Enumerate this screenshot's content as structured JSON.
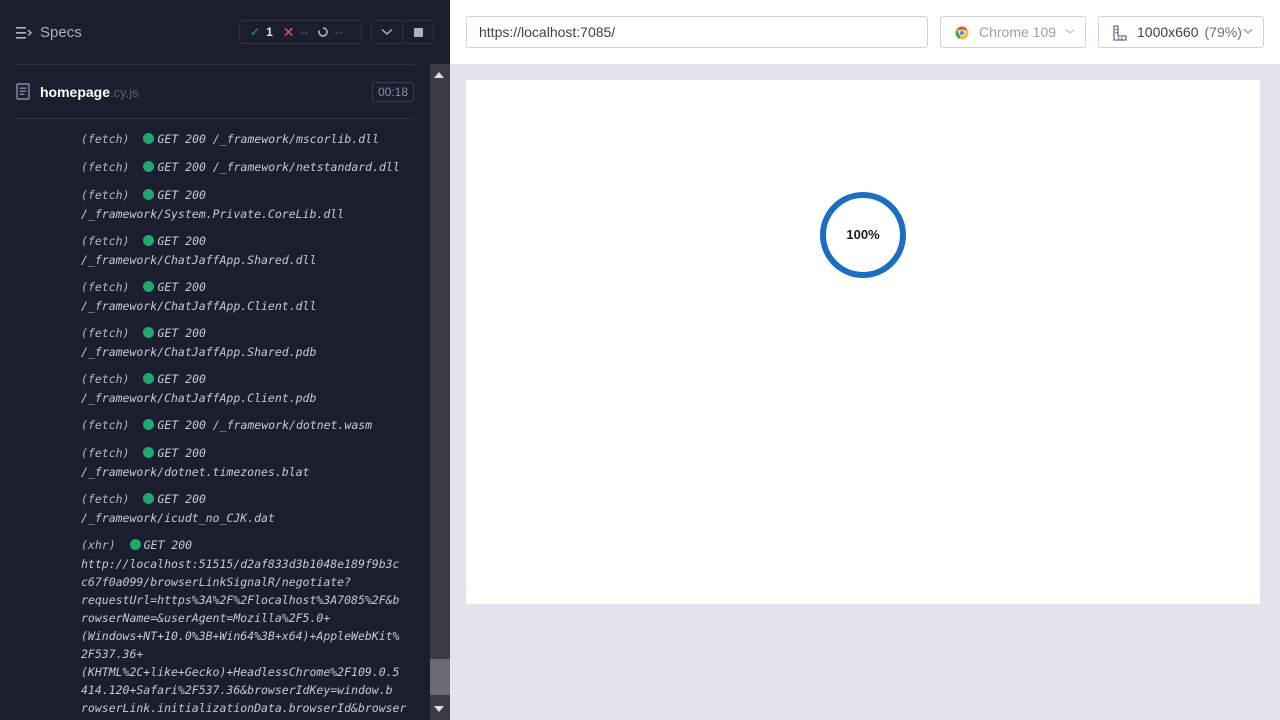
{
  "reporter": {
    "specs_label": "Specs",
    "stats": {
      "passed": "1",
      "failed": "--",
      "pending": "--"
    },
    "spec": {
      "name": "homepage",
      "ext": ".cy.js",
      "duration": "00:18"
    },
    "log": [
      {
        "kind": "(fetch)",
        "lines": [
          "GET 200 /_framework/mscorlib.dll"
        ]
      },
      {
        "kind": "(fetch)",
        "lines": [
          "GET 200 /_framework/netstandard.dll"
        ]
      },
      {
        "kind": "(fetch)",
        "lines": [
          "GET 200",
          "/_framework/System.Private.CoreLib.dll"
        ]
      },
      {
        "kind": "(fetch)",
        "lines": [
          "GET 200",
          "/_framework/ChatJaffApp.Shared.dll"
        ]
      },
      {
        "kind": "(fetch)",
        "lines": [
          "GET 200",
          "/_framework/ChatJaffApp.Client.dll"
        ]
      },
      {
        "kind": "(fetch)",
        "lines": [
          "GET 200",
          "/_framework/ChatJaffApp.Shared.pdb"
        ]
      },
      {
        "kind": "(fetch)",
        "lines": [
          "GET 200",
          "/_framework/ChatJaffApp.Client.pdb"
        ]
      },
      {
        "kind": "(fetch)",
        "lines": [
          "GET 200 /_framework/dotnet.wasm"
        ]
      },
      {
        "kind": "(fetch)",
        "lines": [
          "GET 200",
          "/_framework/dotnet.timezones.blat"
        ]
      },
      {
        "kind": "(fetch)",
        "lines": [
          "GET 200",
          "/_framework/icudt_no_CJK.dat"
        ]
      },
      {
        "kind": "(xhr)",
        "lines": [
          "GET 200",
          "http://localhost:51515/d2af833d3b1048e189f9b3c",
          "c67f0a099/browserLinkSignalR/negotiate?",
          "requestUrl=https%3A%2F%2Flocalhost%3A7085%2F&b",
          "rowserName=&userAgent=Mozilla%2F5.0+",
          "(Windows+NT+10.0%3B+Win64%3B+x64)+AppleWebKit%",
          "2F537.36+",
          "(KHTML%2C+like+Gecko)+HeadlessChrome%2F109.0.5",
          "414.120+Safari%2F537.36&browserIdKey=window.b",
          "rowserLink.initializationData.browserId&browser"
        ]
      }
    ]
  },
  "topbar": {
    "url": "https://localhost:7085/",
    "browser": "Chrome 109",
    "viewport": "1000x660",
    "scale": "(79%)"
  },
  "app": {
    "loader_text": "100%",
    "loader_progress": 1.0,
    "loader_color": "#1b6ec2"
  },
  "colors": {
    "passed": "#1fa971",
    "failed": "#e45770",
    "reporter_bg": "#1b1e2e"
  }
}
